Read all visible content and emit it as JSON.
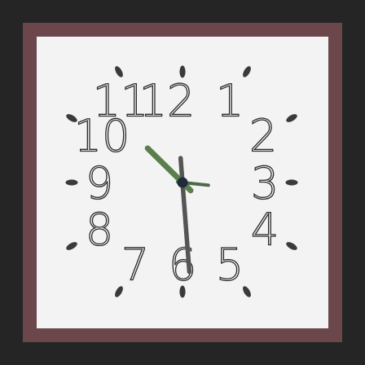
{
  "clock": {
    "numerals": [
      "12",
      "1",
      "2",
      "3",
      "4",
      "5",
      "6",
      "7",
      "8",
      "9",
      "10",
      "11"
    ],
    "time": {
      "hour": 10,
      "minute": 29,
      "second": 16
    },
    "colors": {
      "background": "#252525",
      "frame": "#6b474c",
      "face": "#f3f3f3",
      "numeral_outline": "#2b2b2b",
      "tick": "#3a3a3a",
      "hour_hand": "#5b7e4d",
      "minute_hand": "#555555",
      "second_hand": "#4a6a48",
      "center_cap": "#1f2a3a"
    }
  }
}
